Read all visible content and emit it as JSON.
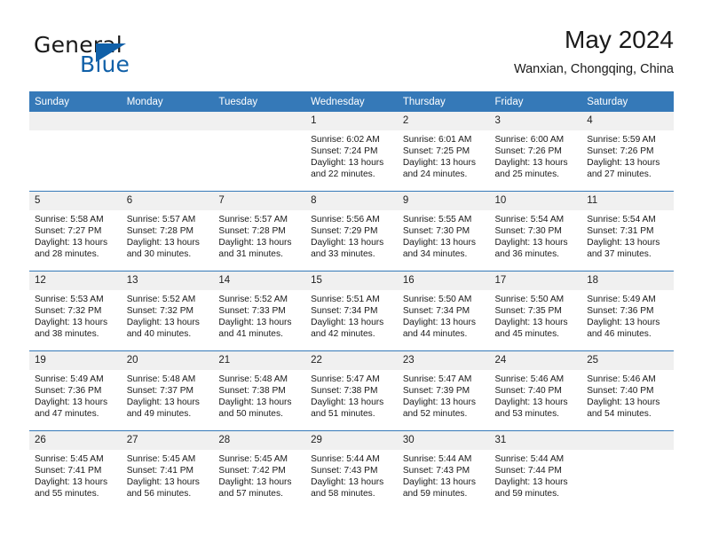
{
  "logo": {
    "word_one": "General",
    "word_two": "Blue"
  },
  "header": {
    "title": "May 2024",
    "subtitle": "Wanxian, Chongqing, China"
  },
  "colors": {
    "header_blue": "#3579b8",
    "logo_blue": "#1060a8",
    "daynum_bg": "#f0f0f0"
  },
  "weekday_headers": [
    "Sunday",
    "Monday",
    "Tuesday",
    "Wednesday",
    "Thursday",
    "Friday",
    "Saturday"
  ],
  "weeks": [
    [
      {
        "day": "",
        "sunrise": "",
        "sunset": "",
        "daylight_line1": "",
        "daylight_line2": ""
      },
      {
        "day": "",
        "sunrise": "",
        "sunset": "",
        "daylight_line1": "",
        "daylight_line2": ""
      },
      {
        "day": "",
        "sunrise": "",
        "sunset": "",
        "daylight_line1": "",
        "daylight_line2": ""
      },
      {
        "day": "1",
        "sunrise": "Sunrise: 6:02 AM",
        "sunset": "Sunset: 7:24 PM",
        "daylight_line1": "Daylight: 13 hours",
        "daylight_line2": "and 22 minutes."
      },
      {
        "day": "2",
        "sunrise": "Sunrise: 6:01 AM",
        "sunset": "Sunset: 7:25 PM",
        "daylight_line1": "Daylight: 13 hours",
        "daylight_line2": "and 24 minutes."
      },
      {
        "day": "3",
        "sunrise": "Sunrise: 6:00 AM",
        "sunset": "Sunset: 7:26 PM",
        "daylight_line1": "Daylight: 13 hours",
        "daylight_line2": "and 25 minutes."
      },
      {
        "day": "4",
        "sunrise": "Sunrise: 5:59 AM",
        "sunset": "Sunset: 7:26 PM",
        "daylight_line1": "Daylight: 13 hours",
        "daylight_line2": "and 27 minutes."
      }
    ],
    [
      {
        "day": "5",
        "sunrise": "Sunrise: 5:58 AM",
        "sunset": "Sunset: 7:27 PM",
        "daylight_line1": "Daylight: 13 hours",
        "daylight_line2": "and 28 minutes."
      },
      {
        "day": "6",
        "sunrise": "Sunrise: 5:57 AM",
        "sunset": "Sunset: 7:28 PM",
        "daylight_line1": "Daylight: 13 hours",
        "daylight_line2": "and 30 minutes."
      },
      {
        "day": "7",
        "sunrise": "Sunrise: 5:57 AM",
        "sunset": "Sunset: 7:28 PM",
        "daylight_line1": "Daylight: 13 hours",
        "daylight_line2": "and 31 minutes."
      },
      {
        "day": "8",
        "sunrise": "Sunrise: 5:56 AM",
        "sunset": "Sunset: 7:29 PM",
        "daylight_line1": "Daylight: 13 hours",
        "daylight_line2": "and 33 minutes."
      },
      {
        "day": "9",
        "sunrise": "Sunrise: 5:55 AM",
        "sunset": "Sunset: 7:30 PM",
        "daylight_line1": "Daylight: 13 hours",
        "daylight_line2": "and 34 minutes."
      },
      {
        "day": "10",
        "sunrise": "Sunrise: 5:54 AM",
        "sunset": "Sunset: 7:30 PM",
        "daylight_line1": "Daylight: 13 hours",
        "daylight_line2": "and 36 minutes."
      },
      {
        "day": "11",
        "sunrise": "Sunrise: 5:54 AM",
        "sunset": "Sunset: 7:31 PM",
        "daylight_line1": "Daylight: 13 hours",
        "daylight_line2": "and 37 minutes."
      }
    ],
    [
      {
        "day": "12",
        "sunrise": "Sunrise: 5:53 AM",
        "sunset": "Sunset: 7:32 PM",
        "daylight_line1": "Daylight: 13 hours",
        "daylight_line2": "and 38 minutes."
      },
      {
        "day": "13",
        "sunrise": "Sunrise: 5:52 AM",
        "sunset": "Sunset: 7:32 PM",
        "daylight_line1": "Daylight: 13 hours",
        "daylight_line2": "and 40 minutes."
      },
      {
        "day": "14",
        "sunrise": "Sunrise: 5:52 AM",
        "sunset": "Sunset: 7:33 PM",
        "daylight_line1": "Daylight: 13 hours",
        "daylight_line2": "and 41 minutes."
      },
      {
        "day": "15",
        "sunrise": "Sunrise: 5:51 AM",
        "sunset": "Sunset: 7:34 PM",
        "daylight_line1": "Daylight: 13 hours",
        "daylight_line2": "and 42 minutes."
      },
      {
        "day": "16",
        "sunrise": "Sunrise: 5:50 AM",
        "sunset": "Sunset: 7:34 PM",
        "daylight_line1": "Daylight: 13 hours",
        "daylight_line2": "and 44 minutes."
      },
      {
        "day": "17",
        "sunrise": "Sunrise: 5:50 AM",
        "sunset": "Sunset: 7:35 PM",
        "daylight_line1": "Daylight: 13 hours",
        "daylight_line2": "and 45 minutes."
      },
      {
        "day": "18",
        "sunrise": "Sunrise: 5:49 AM",
        "sunset": "Sunset: 7:36 PM",
        "daylight_line1": "Daylight: 13 hours",
        "daylight_line2": "and 46 minutes."
      }
    ],
    [
      {
        "day": "19",
        "sunrise": "Sunrise: 5:49 AM",
        "sunset": "Sunset: 7:36 PM",
        "daylight_line1": "Daylight: 13 hours",
        "daylight_line2": "and 47 minutes."
      },
      {
        "day": "20",
        "sunrise": "Sunrise: 5:48 AM",
        "sunset": "Sunset: 7:37 PM",
        "daylight_line1": "Daylight: 13 hours",
        "daylight_line2": "and 49 minutes."
      },
      {
        "day": "21",
        "sunrise": "Sunrise: 5:48 AM",
        "sunset": "Sunset: 7:38 PM",
        "daylight_line1": "Daylight: 13 hours",
        "daylight_line2": "and 50 minutes."
      },
      {
        "day": "22",
        "sunrise": "Sunrise: 5:47 AM",
        "sunset": "Sunset: 7:38 PM",
        "daylight_line1": "Daylight: 13 hours",
        "daylight_line2": "and 51 minutes."
      },
      {
        "day": "23",
        "sunrise": "Sunrise: 5:47 AM",
        "sunset": "Sunset: 7:39 PM",
        "daylight_line1": "Daylight: 13 hours",
        "daylight_line2": "and 52 minutes."
      },
      {
        "day": "24",
        "sunrise": "Sunrise: 5:46 AM",
        "sunset": "Sunset: 7:40 PM",
        "daylight_line1": "Daylight: 13 hours",
        "daylight_line2": "and 53 minutes."
      },
      {
        "day": "25",
        "sunrise": "Sunrise: 5:46 AM",
        "sunset": "Sunset: 7:40 PM",
        "daylight_line1": "Daylight: 13 hours",
        "daylight_line2": "and 54 minutes."
      }
    ],
    [
      {
        "day": "26",
        "sunrise": "Sunrise: 5:45 AM",
        "sunset": "Sunset: 7:41 PM",
        "daylight_line1": "Daylight: 13 hours",
        "daylight_line2": "and 55 minutes."
      },
      {
        "day": "27",
        "sunrise": "Sunrise: 5:45 AM",
        "sunset": "Sunset: 7:41 PM",
        "daylight_line1": "Daylight: 13 hours",
        "daylight_line2": "and 56 minutes."
      },
      {
        "day": "28",
        "sunrise": "Sunrise: 5:45 AM",
        "sunset": "Sunset: 7:42 PM",
        "daylight_line1": "Daylight: 13 hours",
        "daylight_line2": "and 57 minutes."
      },
      {
        "day": "29",
        "sunrise": "Sunrise: 5:44 AM",
        "sunset": "Sunset: 7:43 PM",
        "daylight_line1": "Daylight: 13 hours",
        "daylight_line2": "and 58 minutes."
      },
      {
        "day": "30",
        "sunrise": "Sunrise: 5:44 AM",
        "sunset": "Sunset: 7:43 PM",
        "daylight_line1": "Daylight: 13 hours",
        "daylight_line2": "and 59 minutes."
      },
      {
        "day": "31",
        "sunrise": "Sunrise: 5:44 AM",
        "sunset": "Sunset: 7:44 PM",
        "daylight_line1": "Daylight: 13 hours",
        "daylight_line2": "and 59 minutes."
      },
      {
        "day": "",
        "sunrise": "",
        "sunset": "",
        "daylight_line1": "",
        "daylight_line2": ""
      }
    ]
  ]
}
